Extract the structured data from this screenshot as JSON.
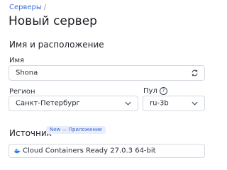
{
  "breadcrumb": {
    "parent": "Серверы",
    "separator": "/"
  },
  "page": {
    "title": "Новый сервер"
  },
  "section": {
    "title": "Имя и расположение"
  },
  "name_field": {
    "label": "Имя",
    "value": "Shona",
    "icon": "refresh-icon"
  },
  "region_field": {
    "label": "Регион",
    "value": "Санкт-Петербург",
    "icon": "chevron-down-icon"
  },
  "pool_field": {
    "label": "Пул",
    "help": "?",
    "value": "ru-3b",
    "icon": "chevron-down-icon"
  },
  "source": {
    "title": "Источник",
    "badge": "New — Приложение",
    "value": "Cloud Containers Ready 27.0.3 64-bit",
    "icon": "docker-whale-icon"
  },
  "colors": {
    "link": "#3b6fd6",
    "badge_bg": "#e8eefc",
    "badge_text": "#3b63c9",
    "border": "#d5d9e1"
  }
}
